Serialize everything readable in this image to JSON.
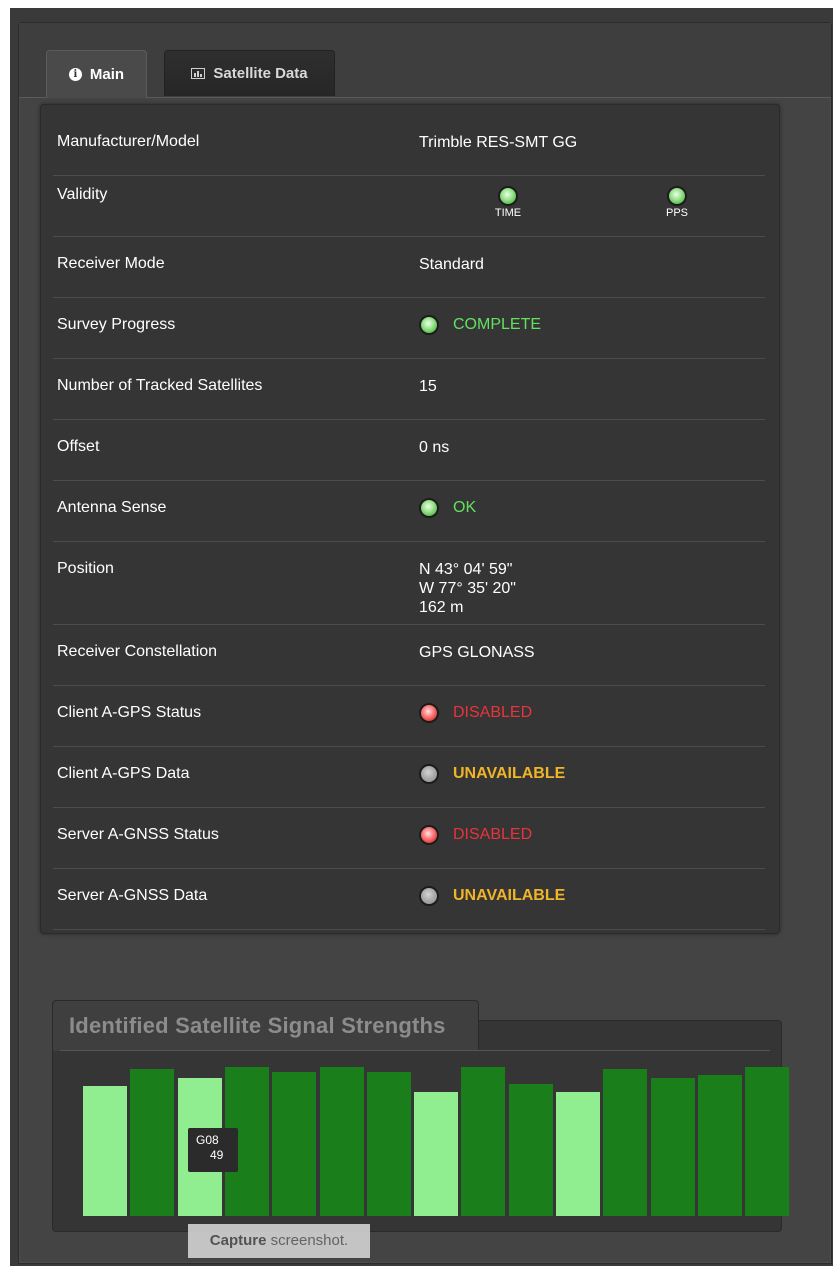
{
  "tabs": [
    {
      "label": "Main",
      "icon": "info-icon",
      "active": true
    },
    {
      "label": "Satellite Data",
      "icon": "bar-chart-icon",
      "active": false
    }
  ],
  "info": {
    "manufacturer_label": "Manufacturer/Model",
    "manufacturer_value": "Trimble RES-SMT GG",
    "validity_label": "Validity",
    "validity_time": "TIME",
    "validity_pps": "PPS",
    "receiver_mode_label": "Receiver Mode",
    "receiver_mode_value": "Standard",
    "survey_label": "Survey Progress",
    "survey_value": "COMPLETE",
    "tracked_label": "Number of Tracked Satellites",
    "tracked_value": "15",
    "offset_label": "Offset",
    "offset_value": "0 ns",
    "antenna_label": "Antenna Sense",
    "antenna_value": "OK",
    "position_label": "Position",
    "position_lat": "N 43° 04' 59\"",
    "position_lon": "W 77° 35' 20\"",
    "position_alt": "162 m",
    "constellation_label": "Receiver Constellation",
    "constellation_value": "GPS GLONASS",
    "client_agps_status_label": "Client A-GPS Status",
    "client_agps_status_value": "DISABLED",
    "client_agps_data_label": "Client A-GPS Data",
    "client_agps_data_value": "UNAVAILABLE",
    "server_agnss_status_label": "Server A-GNSS Status",
    "server_agnss_status_value": "DISABLED",
    "server_agnss_data_label": "Server A-GNSS Data",
    "server_agnss_data_value": "UNAVAILABLE"
  },
  "signal": {
    "title": "Identified Satellite Signal Strengths",
    "tooltip_sat": "G08",
    "tooltip_val": "49"
  },
  "capture_strong": "Capture",
  "capture_rest": "screenshot.",
  "colors": {
    "bar_light": "#90ee90",
    "bar_dark": "#1a7f1a",
    "ok_green": "#63e060",
    "disabled_red": "#e8343a",
    "unavailable_yellow": "#f0b429"
  },
  "chart_data": {
    "type": "bar",
    "title": "Identified Satellite Signal Strengths",
    "categories": [
      "",
      "",
      "G08",
      "",
      "",
      "",
      "",
      "",
      "",
      "",
      "",
      "",
      "",
      "",
      ""
    ],
    "values": [
      46,
      52,
      49,
      53,
      51,
      53,
      51,
      44,
      53,
      47,
      44,
      52,
      49,
      50,
      53
    ],
    "bar_shades": [
      "light",
      "dark",
      "light",
      "dark",
      "dark",
      "dark",
      "dark",
      "light",
      "dark",
      "dark",
      "light",
      "dark",
      "dark",
      "dark",
      "dark"
    ],
    "ylim": [
      0,
      55
    ],
    "grid": false
  }
}
